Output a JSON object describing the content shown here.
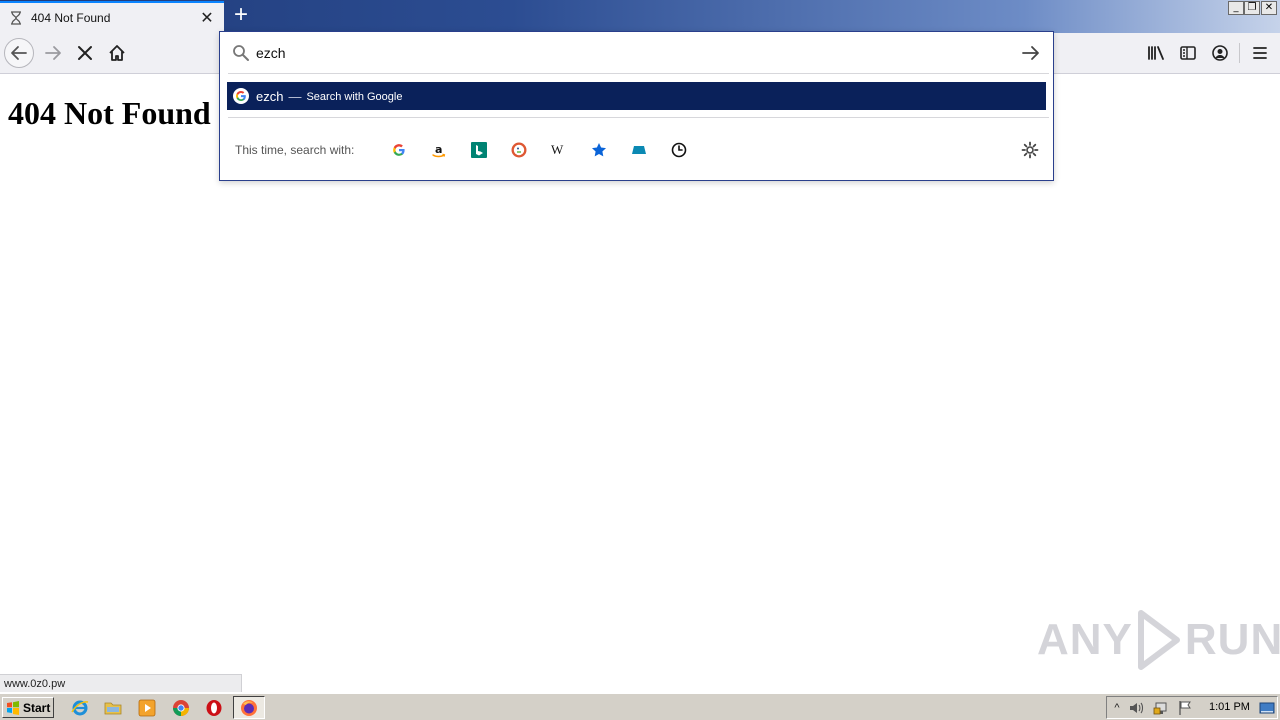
{
  "browser": {
    "tab": {
      "title": "404 Not Found",
      "close_glyph": "✕",
      "icon": "hourglass-loading-icon"
    },
    "new_tab_glyph": "+",
    "window_controls": {
      "minimize": "_",
      "maximize": "❐",
      "close": "✕"
    }
  },
  "page": {
    "heading": "404 Not Found"
  },
  "urlbar": {
    "input_value": "ezch",
    "suggestion": {
      "term": "ezch",
      "separator": "—",
      "action": "Search with Google",
      "engine_icon": "google-icon"
    },
    "one_off_label": "This time, search with:",
    "one_off_engines": [
      "Google",
      "Amazon",
      "Bing",
      "DuckDuckGo",
      "Wikipedia",
      "Bookmarks",
      "Tabs",
      "History"
    ]
  },
  "status_text": "www.0z0.pw",
  "watermark": {
    "left": "ANY",
    "right": "RUN"
  },
  "taskbar": {
    "start_label": "Start",
    "clock": "1:01 PM",
    "tray_show_hidden": "^"
  },
  "colors": {
    "suggestion_highlight": "#0a215a",
    "panel_border": "#2a3f8c",
    "accent": "#0a84ff"
  }
}
